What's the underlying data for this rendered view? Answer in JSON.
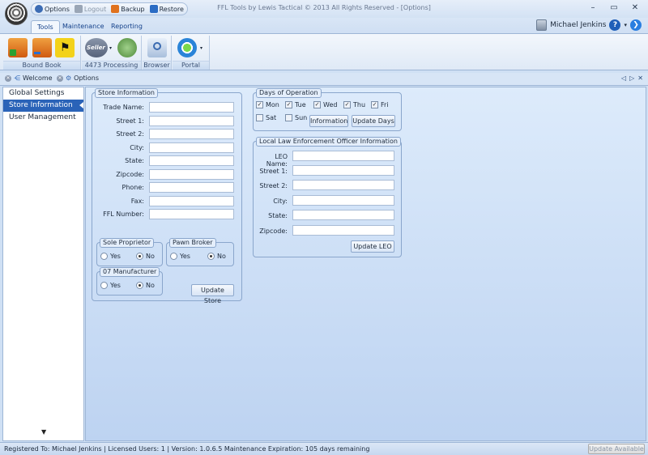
{
  "window": {
    "title": "FFL Tools by Lewis Tactical © 2013 All Rights Reserved - [Options]"
  },
  "quick_access": {
    "options": "Options",
    "logout": "Logout",
    "backup": "Backup",
    "restore": "Restore"
  },
  "ribbon": {
    "tabs": [
      "Tools",
      "Maintenance",
      "Reporting"
    ],
    "active_tab": "Tools",
    "groups": {
      "bound_book": "Bound Book",
      "processing": "4473 Processing",
      "browser": "Browser",
      "portal": "Portal"
    },
    "seller_text": "Seller"
  },
  "user": {
    "name": "Michael Jenkins",
    "help": "?"
  },
  "doc_tabs": {
    "welcome": "Welcome",
    "options": "Options"
  },
  "nav": {
    "items": [
      "Global Settings",
      "Store Information",
      "User Management"
    ],
    "active": "Store Information"
  },
  "store_info": {
    "title": "Store Information",
    "fields": [
      "Trade Name:",
      "Street 1:",
      "Street 2:",
      "City:",
      "State:",
      "Zipcode:",
      "Phone:",
      "Fax:",
      "FFL Number:"
    ],
    "sole_proprietor": {
      "title": "Sole Proprietor",
      "yes": "Yes",
      "no": "No",
      "selected": "No"
    },
    "pawn_broker": {
      "title": "Pawn Broker",
      "yes": "Yes",
      "no": "No",
      "selected": "No"
    },
    "manufacturer": {
      "title": "07 Manufacturer",
      "yes": "Yes",
      "no": "No",
      "selected": "No"
    },
    "update_button": "Update Store"
  },
  "days": {
    "title": "Days of Operation",
    "items": [
      {
        "label": "Mon",
        "checked": true
      },
      {
        "label": "Tue",
        "checked": true
      },
      {
        "label": "Wed",
        "checked": true
      },
      {
        "label": "Thu",
        "checked": true
      },
      {
        "label": "Fri",
        "checked": true
      },
      {
        "label": "Sat",
        "checked": false
      },
      {
        "label": "Sun",
        "checked": false
      }
    ],
    "info_button": "Information",
    "update_button": "Update Days"
  },
  "leo": {
    "title": "Local Law Enforcement Officer Information",
    "fields": [
      "LEO Name:",
      "Street 1:",
      "Street 2:",
      "City:",
      "State:",
      "Zipcode:"
    ],
    "update_button": "Update LEO"
  },
  "status": {
    "text": "Registered To: Michael Jenkins | Licensed Users: 1 | Version: 1.0.6.5  Maintenance Expiration: 105 days remaining",
    "update_button": "Update Available"
  }
}
